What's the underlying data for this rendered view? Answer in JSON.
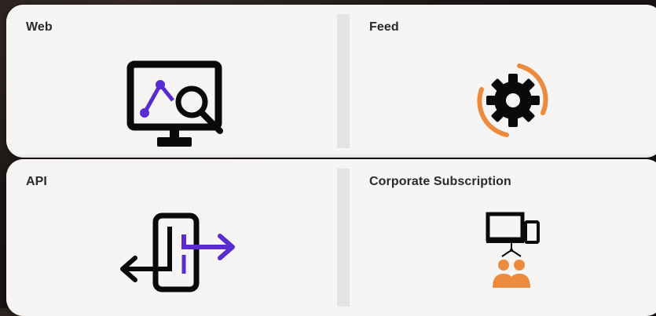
{
  "cards": [
    {
      "title": "Web",
      "icon": "web-analytics-icon"
    },
    {
      "title": "Feed",
      "icon": "feed-gear-sync-icon"
    },
    {
      "title": "API",
      "icon": "api-phone-arrows-icon"
    },
    {
      "title": "Corporate Subscription",
      "icon": "corporate-subscription-icon"
    }
  ],
  "colors": {
    "purple": "#5a2ccf",
    "orange": "#ec8a3d",
    "black": "#0a0a0a"
  }
}
